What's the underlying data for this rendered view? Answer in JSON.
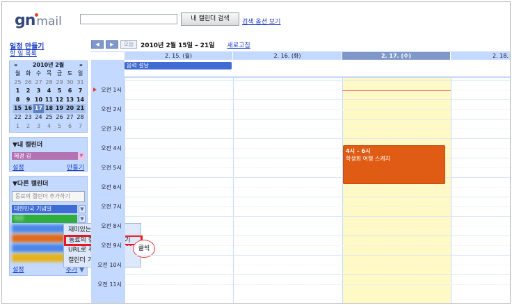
{
  "header": {
    "logo_brand": "gn",
    "logo_suffix": "mail",
    "search_value": "",
    "search_button": "내 캘린더 검색",
    "search_options": "검색 옵션 보기"
  },
  "sidebar": {
    "create_event": "일정 만들기",
    "todo_list": "할 일 목록",
    "minical": {
      "prev": "«",
      "next": "»",
      "title": "2010년 2월",
      "weekdays": [
        "월",
        "화",
        "수",
        "목",
        "금",
        "토",
        "일"
      ],
      "weeks": [
        [
          "25",
          "26",
          "27",
          "28",
          "29",
          "30",
          "31"
        ],
        [
          "1",
          "2",
          "3",
          "4",
          "5",
          "6",
          "7"
        ],
        [
          "8",
          "9",
          "10",
          "11",
          "12",
          "13",
          "14"
        ],
        [
          "15",
          "16",
          "17",
          "18",
          "19",
          "20",
          "21"
        ],
        [
          "22",
          "23",
          "24",
          "25",
          "26",
          "27",
          "28"
        ],
        [
          "1",
          "2",
          "3",
          "4",
          "5",
          "6",
          "7"
        ]
      ]
    },
    "my_calendars": {
      "title": "▼내 캘린더",
      "items": [
        "혜경 김"
      ],
      "settings": "설정",
      "create": "만들기"
    },
    "other_calendars": {
      "title": "▼다른 캘린더",
      "add_placeholder": "동료의 캘린더 추가하기",
      "items": [
        "대한민국 기념일",
        "박준",
        "",
        "",
        "",
        ""
      ],
      "settings": "설정",
      "add": "추가"
    }
  },
  "popup_menu": {
    "items": [
      "재미있는 캘린더 검색",
      "동료의 캘린더 추가하기",
      "URL로 추가",
      "캘린더 가져오기"
    ],
    "callout": "클릭"
  },
  "toolbar": {
    "prev": "◀",
    "next": "▶",
    "today": "오늘",
    "date_range": "2010년 2월 15일 – 21일",
    "refresh": "새로고침"
  },
  "week": {
    "days": [
      "2. 15. (월)",
      "2. 16. (화)",
      "2. 17. (수)",
      "2. 18. ("
    ],
    "hours": [
      "오전 1시",
      "오전 2시",
      "오전 3시",
      "오전 4시",
      "오전 5시",
      "오전 6시",
      "오전 7시",
      "오전 8시",
      "오전 9시",
      "오전 10시",
      "오전 11시"
    ],
    "allday_event": "음력 설날",
    "event": {
      "time": "4시 – 6시",
      "title": "학생회 여행 스케치"
    }
  },
  "colors": {
    "panel": "#c3d9ff",
    "my_calendar": "#b373b3",
    "holiday_calendar": "#3f6bd3",
    "event": "#e05c14",
    "today_column": "#fff9c6",
    "highlight": "#e8161e"
  }
}
